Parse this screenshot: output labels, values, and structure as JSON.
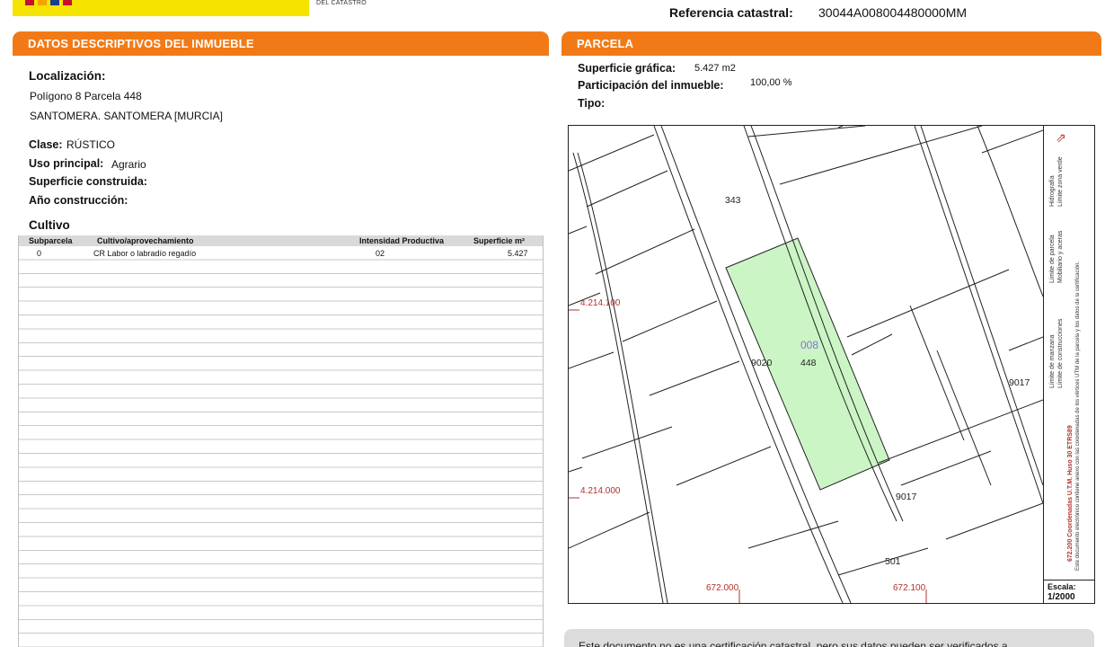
{
  "header": {
    "agency_text": "DEL CATASTRO",
    "ref_label": "Referencia catastral:",
    "ref_value": "30044A008004480000MM",
    "logo_colors": [
      "#c8102e",
      "#f5a300",
      "#1d3e8a",
      "#c8102e"
    ]
  },
  "left_section": {
    "title_prefix": "DATOS DESCRIPTIVOS DEL ",
    "title_bold": "INMUEBLE",
    "localizacion_label": "Localización:",
    "localizacion_line1": "Polígono 8 Parcela 448",
    "localizacion_line2": "SANTOMERA. SANTOMERA [MURCIA]",
    "clase_label": "Clase:",
    "clase_value": "RÚSTICO",
    "uso_label": "Uso principal:",
    "uso_value": "Agrario",
    "superficie_label": "Superficie construida:",
    "anio_label": "Año construcción:",
    "cultivo_label": "Cultivo"
  },
  "table": {
    "headers": [
      "Subparcela",
      "Cultivo/aprovechamiento",
      "Intensidad Productiva",
      "Superficie m²"
    ],
    "rows": [
      [
        "0",
        "CR Labor o labradío regadío",
        "02",
        "5.427"
      ]
    ]
  },
  "right_section": {
    "title": "PARCELA",
    "superficie_grafica_label": "Superficie gráfica:",
    "superficie_grafica_value": "5.427 m2",
    "participacion_label": "Participación del inmueble:",
    "participacion_value": "100,00 %",
    "tipo_label": "Tipo:"
  },
  "map": {
    "parcel_fill": "#ccf5c6",
    "labels": {
      "p343": "343",
      "p9020": "9020",
      "p448": "448",
      "p008": "008",
      "p9017a": "9017",
      "p9017b": "9017",
      "p501": "501"
    },
    "coords": {
      "y1": "4.214.100",
      "y2": "4.214.000",
      "x1": "672.000",
      "x2": "672.100"
    },
    "legend": {
      "l1": "Límite de manzana",
      "l2": "Límite de parcela",
      "l3": "Hidrografía",
      "l4": "Límite de construcciones",
      "l5": "Mobiliario y aceras",
      "l6": "Límite zona verde",
      "coords_note": "672.200 Coordenadas U.T.M. Huso 30 ETRS89",
      "doc_note": "Este documento electrónico contiene anexo con las coordenadas de los vértices UTM de la parcela y los datos de la certificación."
    },
    "scale_label": "Escala:",
    "scale_value": "1/2000"
  },
  "footer": {
    "text": "Este documento no es una certificación catastral, pero sus datos pueden ser verificados a"
  }
}
